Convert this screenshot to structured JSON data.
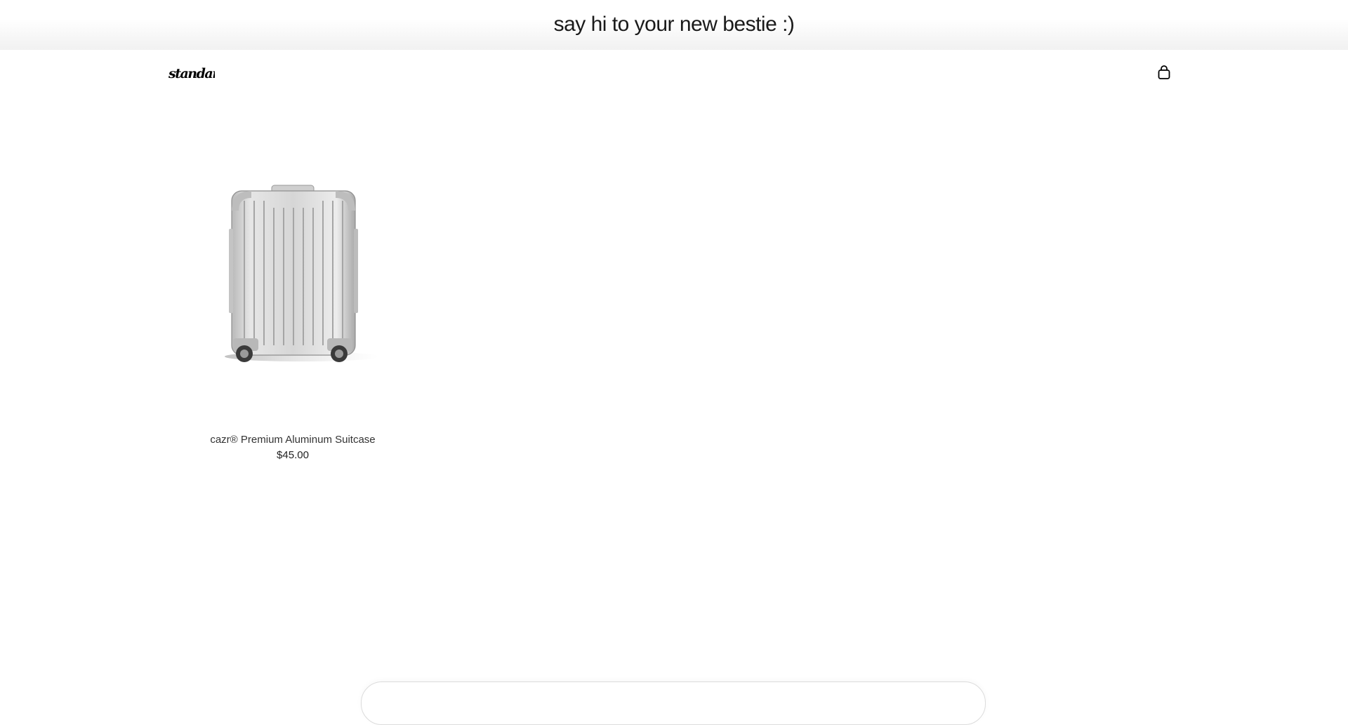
{
  "announcement": {
    "text": "say hi to your new bestie :)"
  },
  "header": {
    "logo_text": "standart",
    "cart_icon": "shopping-bag-icon"
  },
  "products": [
    {
      "title": "cazr® Premium Aluminum Suitcase",
      "price": "$45.00",
      "image_icon": "aluminum-suitcase-image"
    }
  ]
}
